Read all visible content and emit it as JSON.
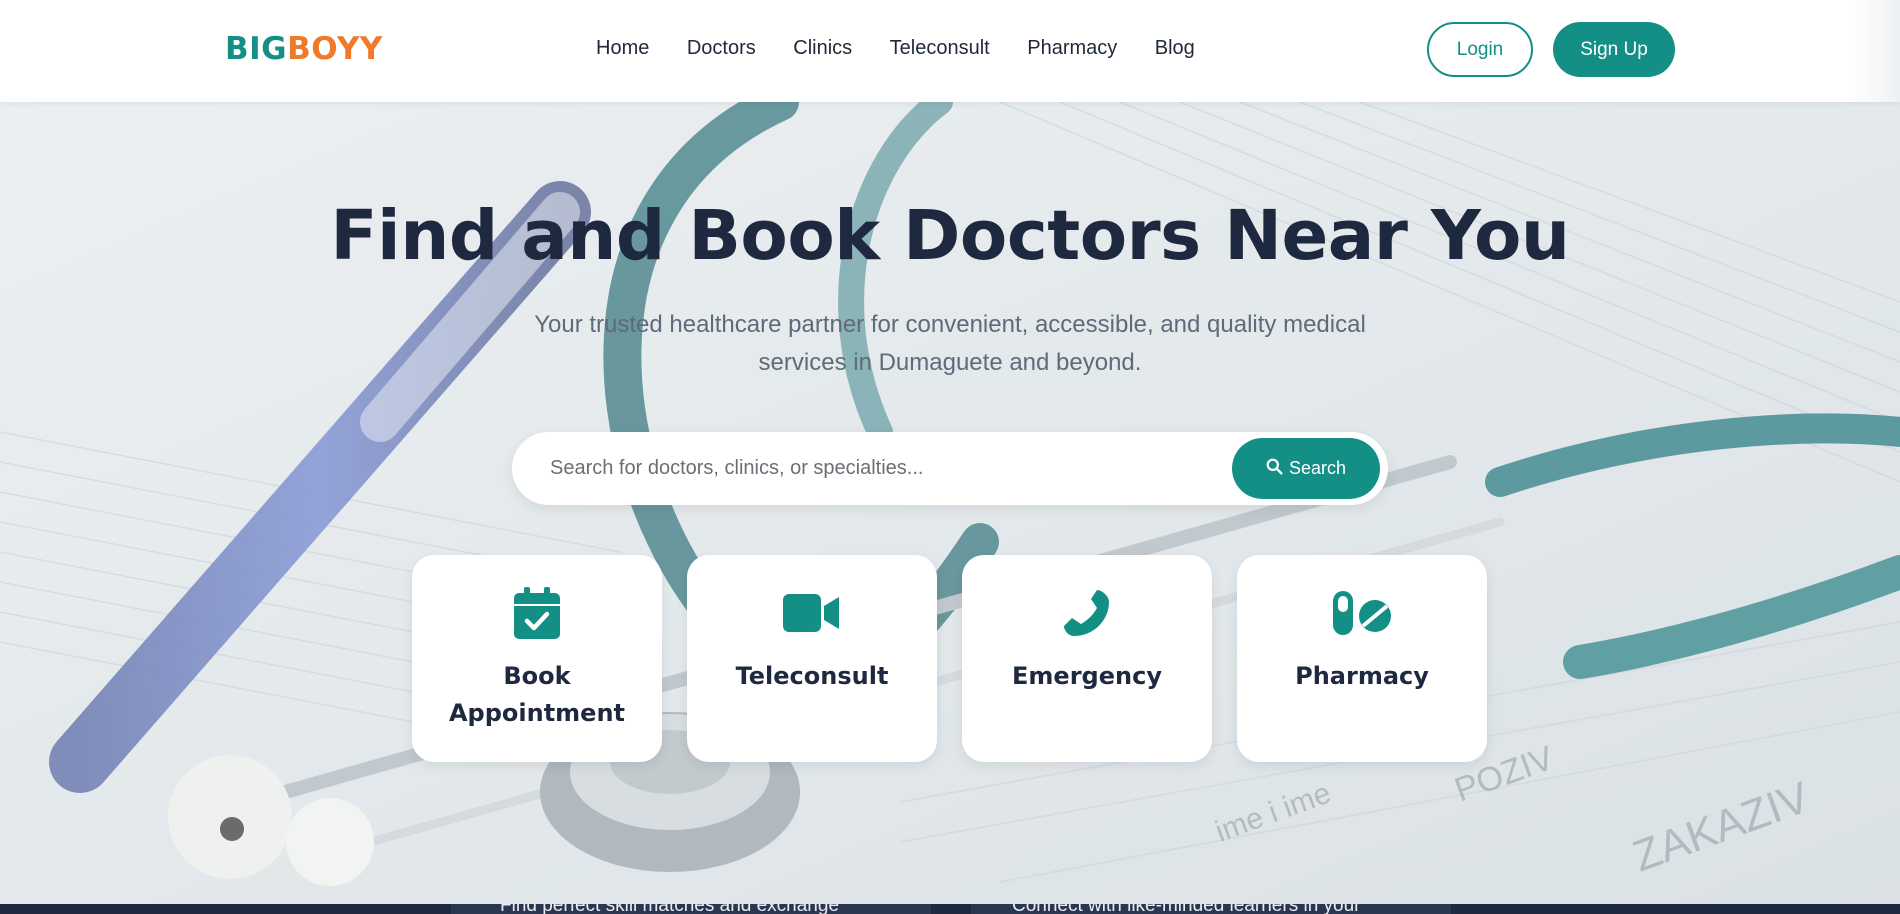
{
  "header": {
    "logo_part1": "BIG",
    "logo_part2": "BOYY",
    "nav": [
      "Home",
      "Doctors",
      "Clinics",
      "Teleconsult",
      "Pharmacy",
      "Blog"
    ],
    "login_label": "Login",
    "signup_label": "Sign Up"
  },
  "hero": {
    "title": "Find and Book Doctors Near You",
    "subtitle": "Your trusted healthcare partner for convenient, accessible, and quality medical services in Dumaguete and beyond.",
    "search": {
      "placeholder": "Search for doctors, clinics, or specialties...",
      "value": "",
      "button_label": "Search"
    },
    "cards": [
      {
        "label": "Book Appointment",
        "icon": "calendar-check-icon"
      },
      {
        "label": "Teleconsult",
        "icon": "video-camera-icon"
      },
      {
        "label": "Emergency",
        "icon": "phone-icon"
      },
      {
        "label": "Pharmacy",
        "icon": "pills-icon"
      }
    ]
  },
  "bottom": {
    "left_text": "Find perfect skill matches and exchange",
    "right_text": "Connect with like-minded learners in your"
  },
  "colors": {
    "brand_teal": "#148f86",
    "brand_orange": "#ee7a2a",
    "heading": "#1e2940"
  }
}
